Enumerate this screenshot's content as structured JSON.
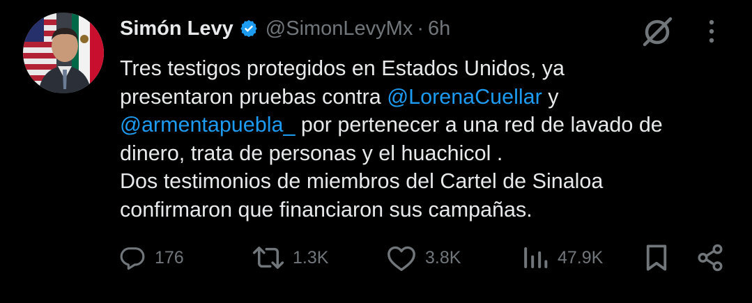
{
  "author": {
    "name": "Simón Levy",
    "handle": "@SimonLevyMx",
    "separator": "·",
    "time": "6h",
    "verified": true
  },
  "tweet": {
    "line1": "Tres testigos protegidos en Estados Unidos, ya",
    "line2_prefix": "presentaron pruebas contra ",
    "mention1": "@LorenaCuellar",
    "line2_suffix": " y",
    "mention2": "@armentapuebla_",
    "line3_suffix": " por pertenecer a una red de lavado de",
    "line4": "dinero, trata de personas y el huachicol .",
    "line5": "Dos testimonios de miembros del Cartel de Sinaloa",
    "line6": "confirmaron que financiaron sus campañas."
  },
  "stats": {
    "replies": "176",
    "reposts": "1.3K",
    "likes": "3.8K",
    "views": "47.9K"
  },
  "icons": {
    "verified": "verified-badge-icon",
    "grok": "grok-icon",
    "more": "more-options-icon",
    "reply": "reply-icon",
    "repost": "repost-icon",
    "like": "like-icon",
    "views": "views-icon",
    "bookmark": "bookmark-icon",
    "share": "share-icon"
  },
  "colors": {
    "background": "#000000",
    "text": "#e7e9ea",
    "secondary": "#71767b",
    "link": "#1d9bf0"
  }
}
